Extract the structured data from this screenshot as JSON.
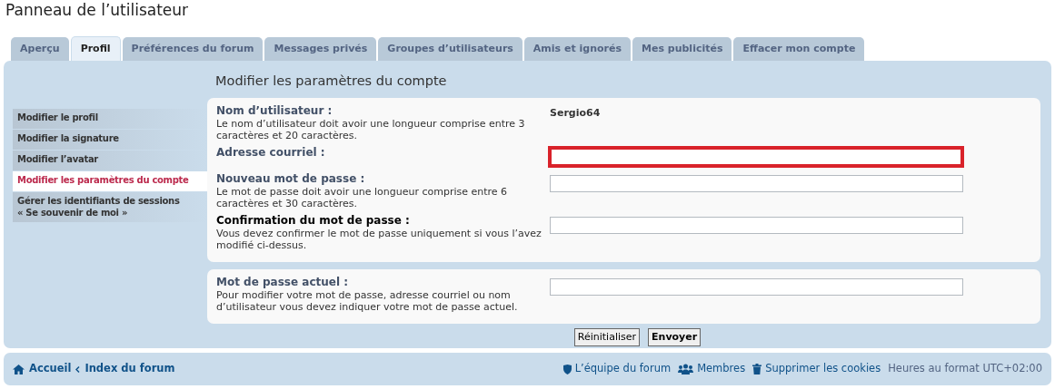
{
  "page_title": "Panneau de l’utilisateur",
  "tabs": [
    {
      "label": "Aperçu",
      "selected": false
    },
    {
      "label": "Profil",
      "selected": true
    },
    {
      "label": "Préférences du forum",
      "selected": false
    },
    {
      "label": "Messages privés",
      "selected": false
    },
    {
      "label": "Groupes d’utilisateurs",
      "selected": false
    },
    {
      "label": "Amis et ignorés",
      "selected": false
    },
    {
      "label": "Mes publicités",
      "selected": false
    },
    {
      "label": "Effacer mon compte",
      "selected": false
    }
  ],
  "section_title": "Modifier les paramètres du compte",
  "sidebar": {
    "items": [
      {
        "label": "Modifier le profil",
        "selected": false
      },
      {
        "label": "Modifier la signature",
        "selected": false
      },
      {
        "label": "Modifier l’avatar",
        "selected": false
      },
      {
        "label": "Modifier les paramètres du compte",
        "selected": true
      },
      {
        "label": "Gérer les identifiants de sessions\n« Se souvenir de moi »",
        "selected": false
      }
    ]
  },
  "fields": [
    {
      "kind": "static",
      "label": "Nom d’utilisateur :",
      "hint": "Le nom d’utilisateur doit avoir une longueur comprise entre 3 caractères et 20 caractères.",
      "value": "Sergio64"
    },
    {
      "kind": "input",
      "label": "Adresse courriel :",
      "highlighted": true
    },
    {
      "kind": "input",
      "label": "Nouveau mot de passe :",
      "hint": "Le mot de passe doit avoir une longueur comprise entre 6 caractères et 30 caractères.",
      "highlighted": false
    },
    {
      "kind": "input",
      "label": "Confirmation du mot de passe :",
      "hint": "Vous devez confirmer le mot de passe uniquement si vous l’avez modifié ci-dessus.",
      "highlighted": false,
      "label_dark": true
    }
  ],
  "current_password": {
    "label": "Mot de passe actuel :",
    "hint": "Pour modifier votre mot de passe, adresse courriel ou nom d’utilisateur vous devez indiquer votre mot de passe actuel."
  },
  "buttons": [
    {
      "label": "Réinitialiser",
      "primary": false
    },
    {
      "label": "Envoyer",
      "primary": true
    }
  ],
  "footer": {
    "breadcrumbs": [
      "Accueil",
      "Index du forum"
    ],
    "links": [
      "L’équipe du forum",
      "Membres",
      "Supprimer les cookies"
    ],
    "timezone": "Heures au format UTC+02:00"
  }
}
